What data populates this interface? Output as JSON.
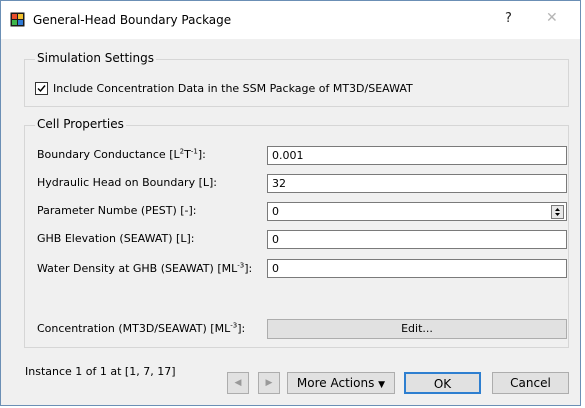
{
  "window": {
    "title": "General-Head Boundary Package",
    "help_label": "?",
    "close_label": "✕"
  },
  "simulation_settings": {
    "group_title": "Simulation Settings",
    "include_concentration": {
      "label": "Include Concentration Data in the SSM Package of MT3D/SEAWAT",
      "checked": true
    }
  },
  "cell_properties": {
    "group_title": "Cell Properties",
    "rows": [
      {
        "label_pre": "Boundary Conductance [L",
        "sup1": "2",
        "label_mid": "T",
        "sup2": "-1",
        "label_post": "]:",
        "value": "0.001"
      },
      {
        "label": "Hydraulic Head on Boundary  [L]:",
        "value": "32"
      },
      {
        "label": "Parameter Numbe (PEST) [-]:",
        "value": "0"
      },
      {
        "label": "GHB Elevation (SEAWAT) [L]:",
        "value": "0"
      },
      {
        "label_pre": "Water Density at GHB (SEAWAT) [ML",
        "sup": "-3",
        "label_post": "]:",
        "value": "0"
      },
      {
        "label_pre": "Concentration (MT3D/SEAWAT) [ML",
        "sup": "-3",
        "label_post": "]:",
        "button": "Edit..."
      }
    ]
  },
  "status": {
    "instance_text": "Instance 1 of 1 at [1, 7, 17]"
  },
  "footer": {
    "prev_label": "◀",
    "next_label": "▶",
    "more_actions_label": "More Actions",
    "more_actions_caret": "▼",
    "ok_label": "OK",
    "cancel_label": "Cancel"
  },
  "colors": {
    "ok_border": "#2e7fd0",
    "window_border": "#6b8fb5"
  }
}
